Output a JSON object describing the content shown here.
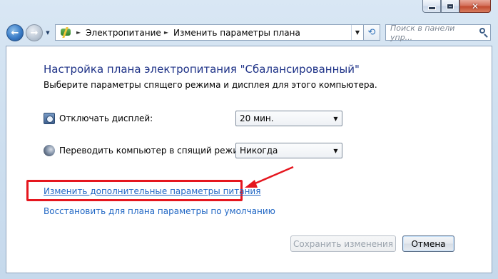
{
  "window": {
    "close_glyph": "✕"
  },
  "nav": {
    "back_glyph": "←",
    "forward_glyph": "→",
    "history_glyph": "▼",
    "address_icon": "power-options-icon",
    "breadcrumbs": [
      "Электропитание",
      "Изменить параметры плана"
    ],
    "crumb_separator": "►",
    "dropdown_glyph": "▼",
    "refresh_glyph": "⟲",
    "search_placeholder": "Поиск в панели упр..."
  },
  "main": {
    "title": "Настройка плана электропитания \"Сбалансированный\"",
    "subtitle": "Выберите параметры спящего режима и дисплея для этого компьютера.",
    "settings": [
      {
        "icon": "display-timer-icon",
        "label": "Отключать дисплей:",
        "value": "20 мин."
      },
      {
        "icon": "sleep-moon-icon",
        "label": "Переводить компьютер в спящий режим:",
        "value": "Никогда"
      }
    ],
    "select_caret": "▼",
    "links": {
      "advanced": "Изменить дополнительные параметры питания",
      "restore": "Восстановить для плана параметры по умолчанию"
    },
    "buttons": {
      "save": "Сохранить изменения",
      "cancel": "Отмена"
    }
  },
  "colors": {
    "title_blue": "#1e3287",
    "link_blue": "#1f66c4",
    "highlight_red": "#e5161e",
    "frame_blue": "#cfe0f0"
  }
}
